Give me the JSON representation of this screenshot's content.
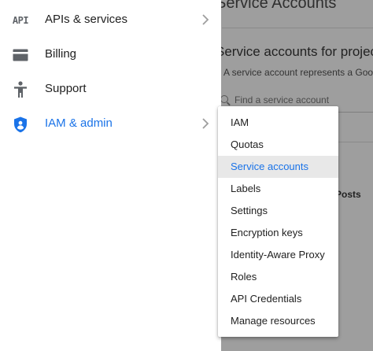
{
  "background": {
    "title": "Service Accounts",
    "subtitle": "Service accounts for project",
    "description": "A service account represents a Google",
    "search_placeholder": "Find a service account",
    "table_cell_text": "Posts"
  },
  "nav": {
    "items": [
      {
        "label": "APIs & services",
        "icon": "api-icon",
        "has_chevron": true
      },
      {
        "label": "Billing",
        "icon": "billing-card-icon",
        "has_chevron": false
      },
      {
        "label": "Support",
        "icon": "support-person-icon",
        "has_chevron": false
      },
      {
        "label": "IAM & admin",
        "icon": "shield-icon",
        "has_chevron": true,
        "active": true
      }
    ],
    "api_icon_text": "API"
  },
  "submenu": {
    "items": [
      {
        "label": "IAM"
      },
      {
        "label": "Quotas"
      },
      {
        "label": "Service accounts",
        "selected": true
      },
      {
        "label": "Labels"
      },
      {
        "label": "Settings"
      },
      {
        "label": "Encryption keys"
      },
      {
        "label": "Identity-Aware Proxy"
      },
      {
        "label": "Roles"
      },
      {
        "label": "API Credentials"
      },
      {
        "label": "Manage resources"
      }
    ]
  },
  "colors": {
    "accent": "#1a73e8",
    "icon_gray": "#5f6368",
    "scrim": "#9e9e9e",
    "selected_bg": "#e8e8e8"
  }
}
